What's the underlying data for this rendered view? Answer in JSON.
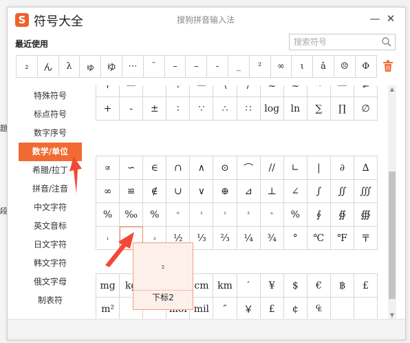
{
  "title_bar": {
    "app_title": "符号大全",
    "window_title": "搜狗拼音输入法",
    "minimize_label": "—",
    "close_label": "✕"
  },
  "recent": {
    "label": "最近使用",
    "symbols": [
      "₂",
      "ん",
      "λ",
      "ゅ",
      "ゆ",
      "⋯",
      "¨",
      "–",
      "–",
      "-",
      "_",
      "²",
      "∞",
      "ι",
      "ǎ",
      "☹",
      "Φ"
    ]
  },
  "search": {
    "placeholder": "搜索符号"
  },
  "sidebar": {
    "items": [
      {
        "label": "特殊符号"
      },
      {
        "label": "标点符号"
      },
      {
        "label": "数字序号"
      },
      {
        "label": "数学/单位",
        "active": true
      },
      {
        "label": "希腊/拉丁"
      },
      {
        "label": "拼音/注音"
      },
      {
        "label": "中文字符"
      },
      {
        "label": "英文音标"
      },
      {
        "label": "日文字符"
      },
      {
        "label": "韩文字符"
      },
      {
        "label": "俄文字母"
      },
      {
        "label": "制表符"
      }
    ]
  },
  "grid": {
    "block1": [
      [
        "+",
        "—",
        "^",
        "÷",
        "—",
        "\\",
        "/",
        "≈",
        "≈",
        "~",
        "—",
        "≠"
      ],
      [
        "+",
        "-",
        "±",
        "∶",
        "∵",
        "∴",
        "∷",
        "log",
        "ln",
        "∑",
        "∏",
        "∅"
      ]
    ],
    "block2": [
      [
        "∝",
        "∽",
        "∈",
        "∩",
        "∧",
        "⊙",
        "⌒",
        "//",
        "∟",
        "|",
        "∂",
        "∆"
      ],
      [
        "∞",
        "≌",
        "∉",
        "∪",
        "∨",
        "⊕",
        "⊿",
        "⊥",
        "∠",
        "∫",
        "∬",
        "∭"
      ],
      [
        "%",
        "‰",
        "%",
        "⁰",
        "¹",
        "²",
        "³",
        "ⁿ",
        "%",
        "∮",
        "∯",
        "∰"
      ],
      [
        "₁",
        "₂",
        "₃",
        "½",
        "⅓",
        "⅔",
        "¼",
        "¾",
        "°",
        "℃",
        "℉",
        "〒"
      ]
    ],
    "block3": [
      [
        "mg",
        "kg",
        "",
        "",
        "cm",
        "km",
        "′",
        "¥",
        "$",
        "€",
        "฿",
        "£"
      ],
      [
        "m²",
        "",
        "",
        "mol",
        "mil",
        "″",
        "￥",
        "£",
        "¢",
        "₠",
        "",
        ""
      ]
    ]
  },
  "tooltip": {
    "symbol": "₂",
    "name": "下标2"
  },
  "colors": {
    "accent": "#f06a32",
    "border": "#d6d6d6"
  }
}
